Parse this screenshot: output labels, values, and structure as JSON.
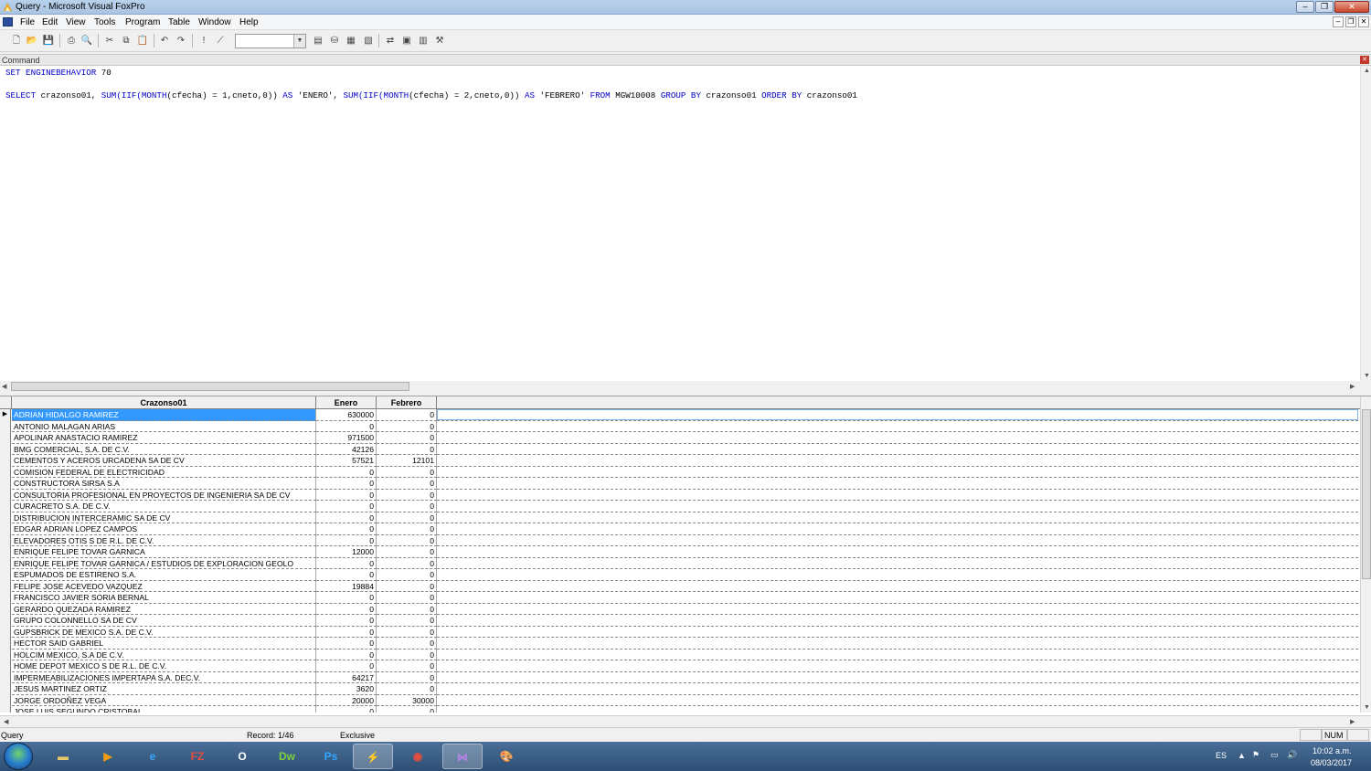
{
  "window": {
    "title": "Query - Microsoft Visual FoxPro"
  },
  "menu": [
    "File",
    "Edit",
    "View",
    "Tools",
    "Program",
    "Table",
    "Window",
    "Help"
  ],
  "command": {
    "title": "Command",
    "line1_kw": "SET ENGINEBEHAVIOR",
    "line1_val": " 70",
    "line2": [
      {
        "t": "SELECT",
        "k": true
      },
      {
        "t": " crazonso01, ",
        "k": false
      },
      {
        "t": "SUM(IIF(MONTH",
        "k": true
      },
      {
        "t": "(cfecha) = 1,cneto,0)) ",
        "k": false
      },
      {
        "t": "AS",
        "k": true
      },
      {
        "t": " 'ENERO', ",
        "k": false
      },
      {
        "t": "SUM(IIF(MONTH",
        "k": true
      },
      {
        "t": "(cfecha) = 2,cneto,0)) ",
        "k": false
      },
      {
        "t": "AS",
        "k": true
      },
      {
        "t": " 'FEBRERO' ",
        "k": false
      },
      {
        "t": "FROM",
        "k": true
      },
      {
        "t": " MGW10008 ",
        "k": false
      },
      {
        "t": "GROUP BY",
        "k": true
      },
      {
        "t": " crazonso01 ",
        "k": false
      },
      {
        "t": "ORDER BY",
        "k": true
      },
      {
        "t": " crazonso01",
        "k": false
      }
    ]
  },
  "grid": {
    "columns": [
      "Crazonso01",
      "Enero",
      "Febrero"
    ],
    "rows": [
      [
        "ADRIAN HIDALGO RAMIREZ",
        "630000",
        "0"
      ],
      [
        "ANTONIO MALAGAN ARIAS",
        "0",
        "0"
      ],
      [
        "APOLINAR ANASTACIO RAMIREZ",
        "971500",
        "0"
      ],
      [
        "BMG COMERCIAL, S.A. DE C.V.",
        "42126",
        "0"
      ],
      [
        "CEMENTOS Y ACEROS URCADENA SA DE CV",
        "57521",
        "12101"
      ],
      [
        "COMISION FEDERAL DE ELECTRICIDAD",
        "0",
        "0"
      ],
      [
        "CONSTRUCTORA SIRSA S.A",
        "0",
        "0"
      ],
      [
        "CONSULTORIA PROFESIONAL EN PROYECTOS DE INGENIERIA SA DE CV",
        "0",
        "0"
      ],
      [
        "CURACRETO S.A. DE C.V.",
        "0",
        "0"
      ],
      [
        "DISTRIBUCION INTERCERAMIC SA DE CV",
        "0",
        "0"
      ],
      [
        "EDGAR ADRIAN LOPEZ CAMPOS",
        "0",
        "0"
      ],
      [
        "ELEVADORES OTIS S DE R.L. DE C.V.",
        "0",
        "0"
      ],
      [
        "ENRIQUE FELIPE TOVAR GARNICA",
        "12000",
        "0"
      ],
      [
        "ENRIQUE FELIPE TOVAR GARNICA / ESTUDIOS DE EXPLORACION GEOLO",
        "0",
        "0"
      ],
      [
        "ESPUMADOS DE ESTIRENO S.A.",
        "0",
        "0"
      ],
      [
        "FELIPE JOSE ACEVEDO VAZQUEZ",
        "19884",
        "0"
      ],
      [
        "FRANCISCO JAVIER SORIA BERNAL",
        "0",
        "0"
      ],
      [
        "GERARDO QUEZADA RAMIREZ",
        "0",
        "0"
      ],
      [
        "GRUPO COLONNELLO SA DE CV",
        "0",
        "0"
      ],
      [
        "GUPSBRICK DE MEXICO S.A. DE C.V.",
        "0",
        "0"
      ],
      [
        "HECTOR SAID GABRIEL",
        "0",
        "0"
      ],
      [
        "HOLCIM MEXICO, S.A DE C.V.",
        "0",
        "0"
      ],
      [
        "HOME DEPOT MEXICO S DE R.L. DE C.V.",
        "0",
        "0"
      ],
      [
        "IMPERMEABILIZACIONES IMPERTAPA S.A. DEC.V.",
        "64217",
        "0"
      ],
      [
        "JESUS MARTINEZ ORTIZ",
        "3620",
        "0"
      ],
      [
        "JORGE ORDOÑEZ VEGA",
        "20000",
        "30000"
      ],
      [
        "JOSE LUIS SEGUNDO CRISTOBAL",
        "0",
        "0"
      ]
    ]
  },
  "status": {
    "left": "Query",
    "record": "Record: 1/46",
    "mode": "Exclusive",
    "num": "NUM"
  },
  "taskbar": {
    "lang": "ES",
    "time": "10:02 a.m.",
    "date": "08/03/2017"
  }
}
